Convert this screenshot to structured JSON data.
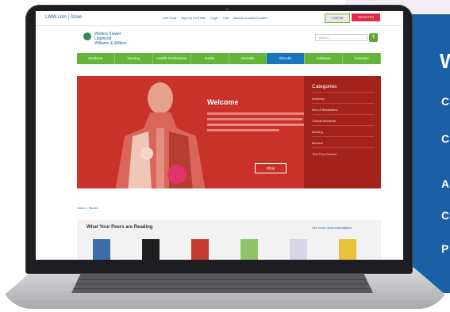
{
  "promo": {
    "lines": [
      "W",
      "C",
      "C",
      "A",
      "C",
      "P"
    ]
  },
  "store_page": {
    "store_name": "LWW.com | Store",
    "top_links": [
      "Live Chat",
      "Sign Up for Email",
      "Login",
      "Cart",
      "Access Journal Content"
    ],
    "login_label": "LOG IN",
    "register_label": "REGISTER",
    "brand_line1": "Wolters Kluwer",
    "brand_line2": "Lippincott",
    "brand_line3": "Williams & Wilkins",
    "search_placeholder": "Search",
    "nav": [
      "Medicine",
      "Nursing",
      "Health Professions",
      "Books",
      "Journals",
      "Ebooks",
      "Software",
      "Societies"
    ],
    "hero": {
      "title": "Welcome",
      "cta": "Shop",
      "side_title": "Categories",
      "side_items": [
        "Anatomy",
        "New & Bestsellers",
        "Clinical Medicine",
        "Nursing",
        "Medical",
        "Test Prep Review"
      ]
    },
    "breadcrumb": "Home > Books",
    "reading": {
      "title": "What Your Peers are Reading",
      "more_link": "See more recommendations"
    }
  },
  "colors": {
    "promo_blue": "#1b5fa6",
    "nav_green": "#64b43c",
    "hero_red": "#c8322a",
    "register_pink": "#e02b4f"
  }
}
